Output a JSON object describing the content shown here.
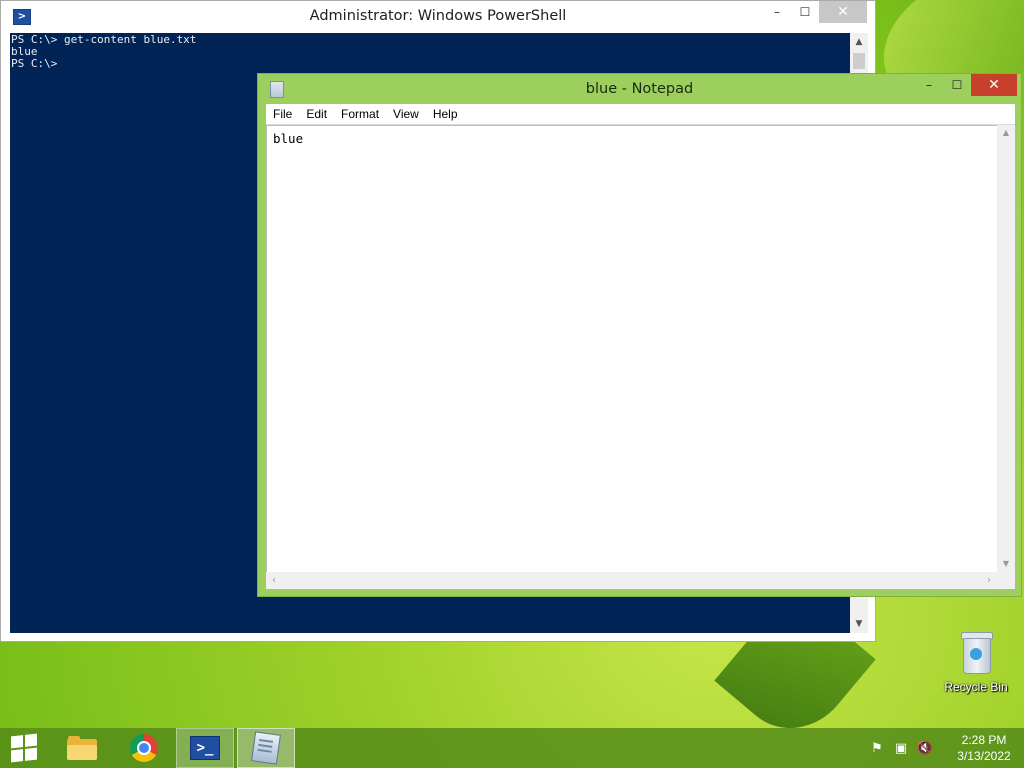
{
  "powershell": {
    "title": "Administrator: Windows PowerShell",
    "icon": "powershell-icon",
    "controls": {
      "minimize": "–",
      "maximize": "☐",
      "close": "✕"
    },
    "lines": [
      "PS C:\\> get-content blue.txt",
      "blue",
      "PS C:\\>"
    ],
    "colors": {
      "background": "#012456",
      "text": "#eeedf0"
    }
  },
  "notepad": {
    "title": "blue - Notepad",
    "icon": "notepad-icon",
    "controls": {
      "minimize": "–",
      "maximize": "☐",
      "close": "✕"
    },
    "menu": [
      "File",
      "Edit",
      "Format",
      "View",
      "Help"
    ],
    "content": "blue",
    "colors": {
      "frame": "#9ccf5e",
      "close": "#c7402c"
    }
  },
  "desktop": {
    "icons": [
      {
        "label": "Recycle Bin",
        "icon": "recycle-bin-icon"
      }
    ]
  },
  "taskbar": {
    "items": [
      "start-icon",
      "file-explorer-icon",
      "chrome-icon",
      "powershell-icon",
      "notepad-icon"
    ],
    "tray_icons": [
      "action-center-flag-icon",
      "network-icon",
      "volume-muted-icon"
    ],
    "clock": {
      "time": "2:28 PM",
      "date": "3/13/2022"
    }
  }
}
